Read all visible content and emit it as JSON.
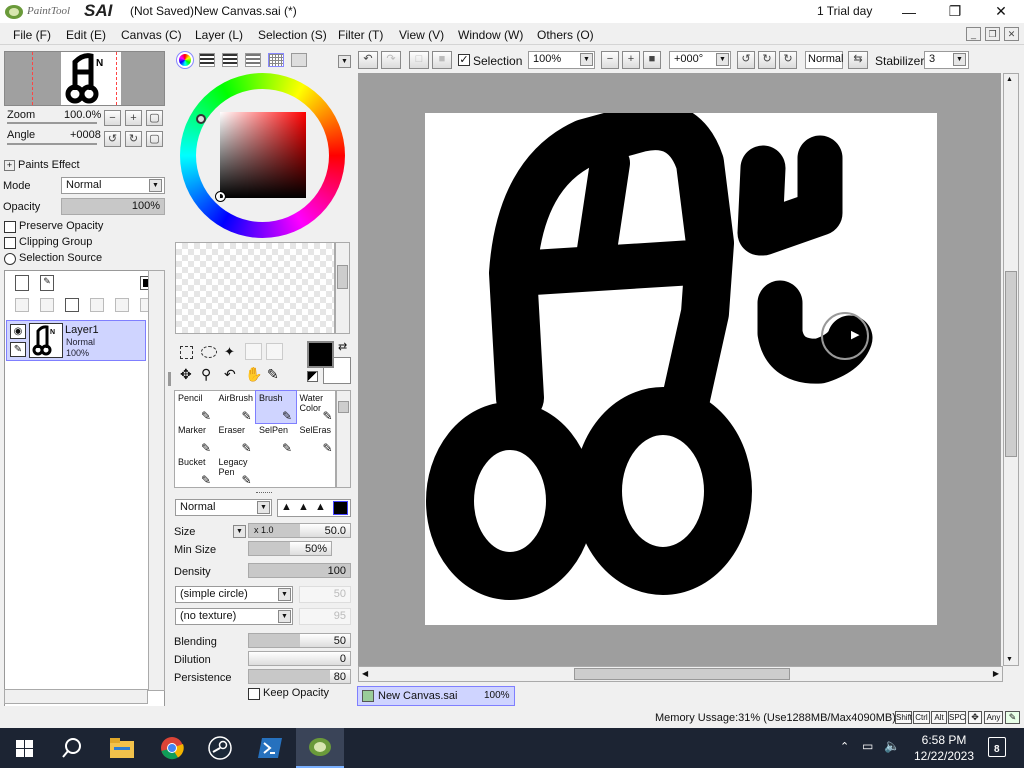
{
  "app": {
    "logo_text": "PaintTool SAI",
    "title": "(Not Saved)New Canvas.sai (*)",
    "trial": "1 Trial day"
  },
  "window_controls": {
    "minimize_icon": "minimize-icon",
    "restore_icon": "restore-icon",
    "close_icon": "close-icon"
  },
  "menu": [
    "File (F)",
    "Edit (E)",
    "Canvas (C)",
    "Layer (L)",
    "Selection (S)",
    "Filter (T)",
    "View (V)",
    "Window (W)",
    "Others (O)"
  ],
  "navigator": {
    "zoom_label": "Zoom",
    "zoom_value": "100.0%",
    "angle_label": "Angle",
    "angle_value": "+0008"
  },
  "layer_panel": {
    "paints_effect": "Paints Effect",
    "mode_label": "Mode",
    "mode_value": "Normal",
    "opacity_label": "Opacity",
    "opacity_value": "100%",
    "opacity_fraction": 1.0,
    "preserve_opacity": "Preserve Opacity",
    "clipping_group": "Clipping Group",
    "selection_source": "Selection Source",
    "layers": [
      {
        "name": "Layer1",
        "mode": "Normal",
        "opacity": "100%"
      }
    ]
  },
  "colors": {
    "primary": "#000000",
    "secondary": "#ffffff",
    "selection": "#cfd4ff",
    "accent_border": "#7f7fff"
  },
  "tools": [
    {
      "label": "Pencil"
    },
    {
      "label": "AirBrush"
    },
    {
      "label": "Brush",
      "selected": true
    },
    {
      "label": "Water Color"
    },
    {
      "label": "Marker"
    },
    {
      "label": "Eraser"
    },
    {
      "label": "SelPen"
    },
    {
      "label": "SelEras"
    },
    {
      "label": "Bucket"
    },
    {
      "label": "Legacy Pen"
    }
  ],
  "brush": {
    "mode": "Normal",
    "size_label": "Size",
    "size_mult": "x 1.0",
    "size_value": "50.0",
    "minsize_label": "Min Size",
    "minsize_value": "50%",
    "minsize_fraction": 0.5,
    "density_label": "Density",
    "density_value": "100",
    "density_fraction": 1.0,
    "shape": "(simple circle)",
    "shape_value": "50",
    "texture": "(no texture)",
    "texture_value": "95",
    "blending_label": "Blending",
    "blending_value": "50",
    "blending_fraction": 0.5,
    "dilution_label": "Dilution",
    "dilution_value": "0",
    "dilution_fraction": 0.0,
    "persistence_label": "Persistence",
    "persistence_value": "80",
    "persistence_fraction": 0.8,
    "keep_opacity": "Keep Opacity"
  },
  "toolbar": {
    "selection_label": "Selection",
    "selection_checked": true,
    "zoom": "100%",
    "angle": "+000°",
    "blend": "Normal",
    "stabilizer_label": "Stabilizer",
    "stabilizer_value": "3"
  },
  "canvas_tab": {
    "name": "New Canvas.sai",
    "zoom": "100%"
  },
  "status": {
    "memory": "Memory Ussage:31% (Use1288MB/Max4090MB)",
    "keys": [
      "Shift",
      "Ctrl",
      "Alt",
      "SPC",
      "Any"
    ]
  },
  "taskbar": {
    "icons": [
      "windows-start-icon",
      "search-icon",
      "file-explorer-icon",
      "chrome-icon",
      "steam-icon",
      "powershell-icon",
      "paint-tool-sai-icon"
    ],
    "time": "6:58 PM",
    "date": "12/22/2023",
    "notifications": "8"
  }
}
